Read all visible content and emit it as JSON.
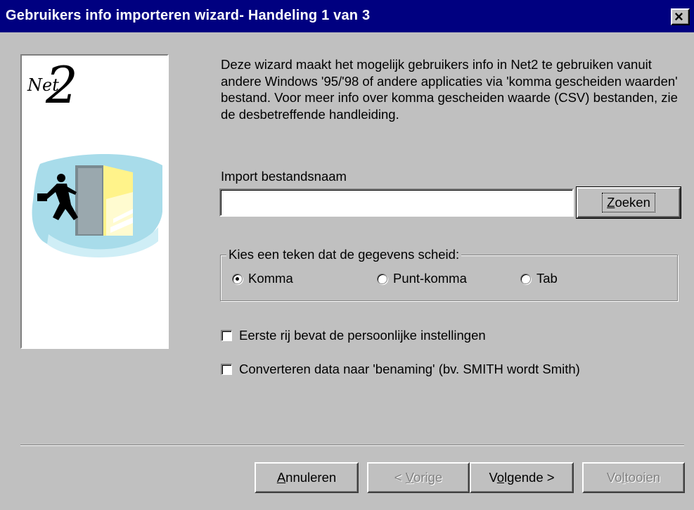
{
  "window": {
    "title": "Gebruikers info importeren wizard- Handeling 1 van 3",
    "close_label": "×"
  },
  "logo": {
    "prefix": "Net",
    "number": "2"
  },
  "description": "Deze wizard maakt het mogelijk gebruikers info in Net2 te gebruiken vanuit andere Windows '95/'98 of andere applicaties via 'komma gescheiden waarden' bestand. Voor meer info over komma gescheiden waarde (CSV) bestanden, zie de desbetreffende handleiding.",
  "import": {
    "label": "Import bestandsnaam",
    "value": "",
    "browse_button": {
      "accel": "Z",
      "rest": "oeken"
    }
  },
  "separator_group": {
    "legend": "Kies een teken dat de gegevens scheid:",
    "options": [
      {
        "label": "Komma",
        "selected": true
      },
      {
        "label": "Punt-komma",
        "selected": false
      },
      {
        "label": "Tab",
        "selected": false
      }
    ]
  },
  "checkboxes": [
    {
      "label": "Eerste rij bevat de persoonlijke instellingen",
      "checked": false
    },
    {
      "label": "Converteren data naar 'benaming' (bv. SMITH wordt Smith)",
      "checked": false
    }
  ],
  "buttons": {
    "cancel": {
      "accel": "A",
      "rest": "nnuleren"
    },
    "back": {
      "pre": "< ",
      "accel": "V",
      "rest": "orige"
    },
    "next": {
      "pre": "V",
      "accel": "o",
      "rest": "lgende >"
    },
    "finish": {
      "pre": "Vo",
      "accel": "l",
      "rest": "tooien"
    }
  },
  "colors": {
    "titlebar": "#000080",
    "face": "#c0c0c0",
    "illustration_sky": "#a8dcea",
    "illustration_door": "#fff38a"
  },
  "icons": {
    "illustration": "businessman-running-through-door"
  }
}
